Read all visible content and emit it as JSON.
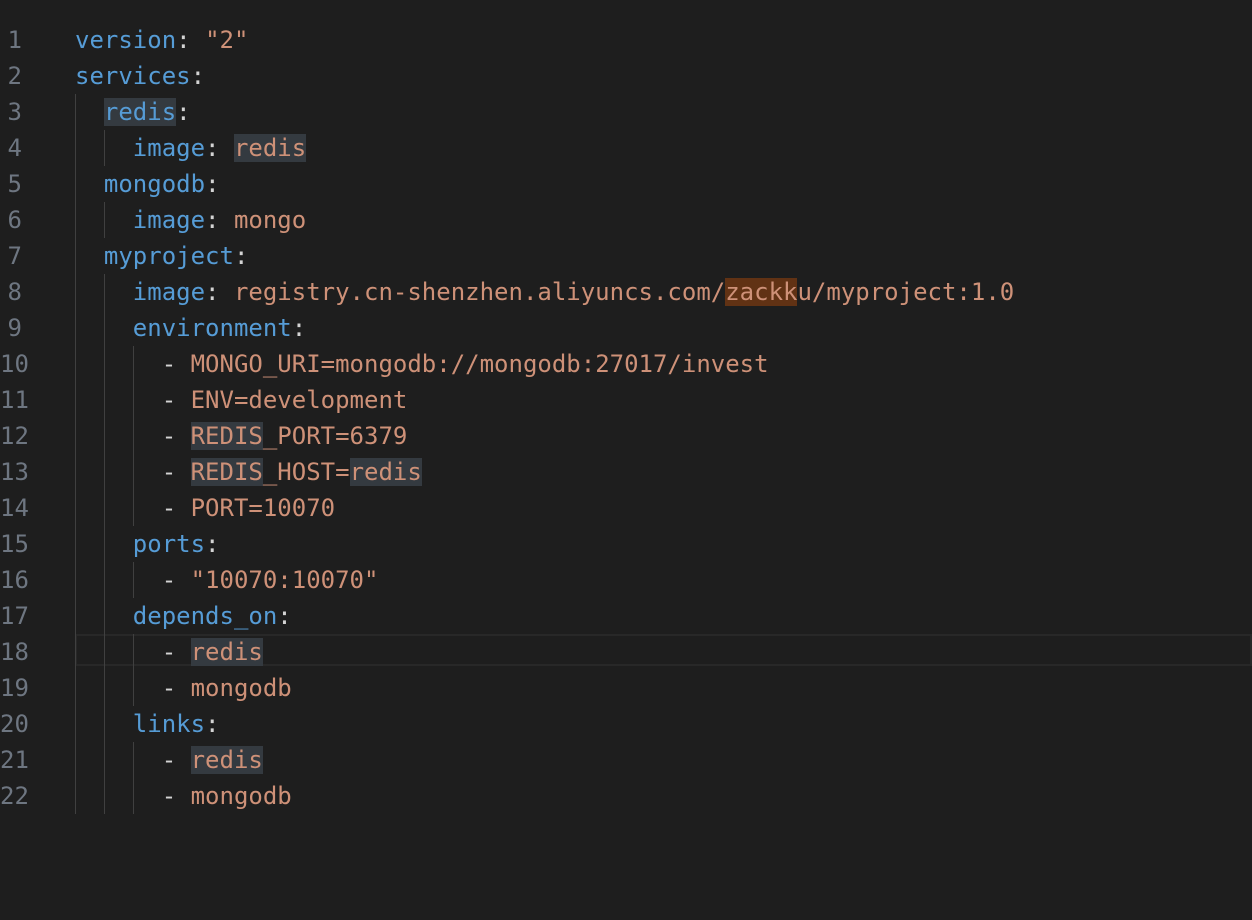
{
  "editor": {
    "language": "yaml",
    "current_line": 18,
    "lines": [
      {
        "number": "1",
        "indent": "",
        "tokens": [
          {
            "text": "version",
            "type": "k"
          },
          {
            "text": ": ",
            "type": "p"
          },
          {
            "text": "\"2\"",
            "type": "s"
          }
        ]
      },
      {
        "number": "2",
        "indent": "",
        "tokens": [
          {
            "text": "services",
            "type": "k"
          },
          {
            "text": ":",
            "type": "p"
          }
        ]
      },
      {
        "number": "3",
        "indent": "  ",
        "tokens": [
          {
            "text": "redis",
            "type": "k",
            "mark": "hl"
          },
          {
            "text": ":",
            "type": "p"
          }
        ]
      },
      {
        "number": "4",
        "indent": "    ",
        "tokens": [
          {
            "text": "image",
            "type": "k"
          },
          {
            "text": ": ",
            "type": "p"
          },
          {
            "text": "redis",
            "type": "s",
            "mark": "hl"
          }
        ]
      },
      {
        "number": "5",
        "indent": "  ",
        "tokens": [
          {
            "text": "mongodb",
            "type": "k"
          },
          {
            "text": ":",
            "type": "p"
          }
        ]
      },
      {
        "number": "6",
        "indent": "    ",
        "tokens": [
          {
            "text": "image",
            "type": "k"
          },
          {
            "text": ": ",
            "type": "p"
          },
          {
            "text": "mongo",
            "type": "s"
          }
        ]
      },
      {
        "number": "7",
        "indent": "  ",
        "tokens": [
          {
            "text": "myproject",
            "type": "k"
          },
          {
            "text": ":",
            "type": "p"
          }
        ]
      },
      {
        "number": "8",
        "indent": "    ",
        "tokens": [
          {
            "text": "image",
            "type": "k"
          },
          {
            "text": ": ",
            "type": "p"
          },
          {
            "text": "registry.cn-shenzhen.aliyuncs.com/",
            "type": "s"
          },
          {
            "text": "zackk",
            "type": "s",
            "mark": "find"
          },
          {
            "text": "u/myproject:1.0",
            "type": "s"
          }
        ]
      },
      {
        "number": "9",
        "indent": "    ",
        "tokens": [
          {
            "text": "environment",
            "type": "k"
          },
          {
            "text": ":",
            "type": "p"
          }
        ]
      },
      {
        "number": "10",
        "indent": "      ",
        "tokens": [
          {
            "text": "- ",
            "type": "p"
          },
          {
            "text": "MONGO_URI=mongodb://mongodb:27017/invest",
            "type": "s"
          }
        ]
      },
      {
        "number": "11",
        "indent": "      ",
        "tokens": [
          {
            "text": "- ",
            "type": "p"
          },
          {
            "text": "ENV=development",
            "type": "s"
          }
        ]
      },
      {
        "number": "12",
        "indent": "      ",
        "tokens": [
          {
            "text": "- ",
            "type": "p"
          },
          {
            "text": "REDIS",
            "type": "s",
            "mark": "hl"
          },
          {
            "text": "_PORT=6379",
            "type": "s"
          }
        ]
      },
      {
        "number": "13",
        "indent": "      ",
        "tokens": [
          {
            "text": "- ",
            "type": "p"
          },
          {
            "text": "REDIS",
            "type": "s",
            "mark": "hl"
          },
          {
            "text": "_HOST=",
            "type": "s"
          },
          {
            "text": "redis",
            "type": "s",
            "mark": "hl"
          }
        ]
      },
      {
        "number": "14",
        "indent": "      ",
        "tokens": [
          {
            "text": "- ",
            "type": "p"
          },
          {
            "text": "PORT=10070",
            "type": "s"
          }
        ]
      },
      {
        "number": "15",
        "indent": "    ",
        "tokens": [
          {
            "text": "ports",
            "type": "k"
          },
          {
            "text": ":",
            "type": "p"
          }
        ]
      },
      {
        "number": "16",
        "indent": "      ",
        "tokens": [
          {
            "text": "- ",
            "type": "p"
          },
          {
            "text": "\"10070:10070\"",
            "type": "s"
          }
        ]
      },
      {
        "number": "17",
        "indent": "    ",
        "tokens": [
          {
            "text": "depends_on",
            "type": "k"
          },
          {
            "text": ":",
            "type": "p"
          }
        ]
      },
      {
        "number": "18",
        "indent": "      ",
        "tokens": [
          {
            "text": "- ",
            "type": "p"
          },
          {
            "text": "redis",
            "type": "s",
            "mark": "hl"
          }
        ]
      },
      {
        "number": "19",
        "indent": "      ",
        "tokens": [
          {
            "text": "- ",
            "type": "p"
          },
          {
            "text": "mongodb",
            "type": "s"
          }
        ]
      },
      {
        "number": "20",
        "indent": "    ",
        "tokens": [
          {
            "text": "links",
            "type": "k"
          },
          {
            "text": ":",
            "type": "p"
          }
        ]
      },
      {
        "number": "21",
        "indent": "      ",
        "tokens": [
          {
            "text": "- ",
            "type": "p"
          },
          {
            "text": "redis",
            "type": "s",
            "mark": "hl"
          }
        ]
      },
      {
        "number": "22",
        "indent": "      ",
        "tokens": [
          {
            "text": "- ",
            "type": "p"
          },
          {
            "text": "mongodb",
            "type": "s"
          }
        ]
      }
    ]
  },
  "colors": {
    "background": "#1e1e1e",
    "key": "#569cd6",
    "string": "#ce9178",
    "punctuation": "#d4d4d4",
    "line_number": "#6e7681",
    "word_highlight": "#343a40",
    "find_match": "#613214"
  }
}
